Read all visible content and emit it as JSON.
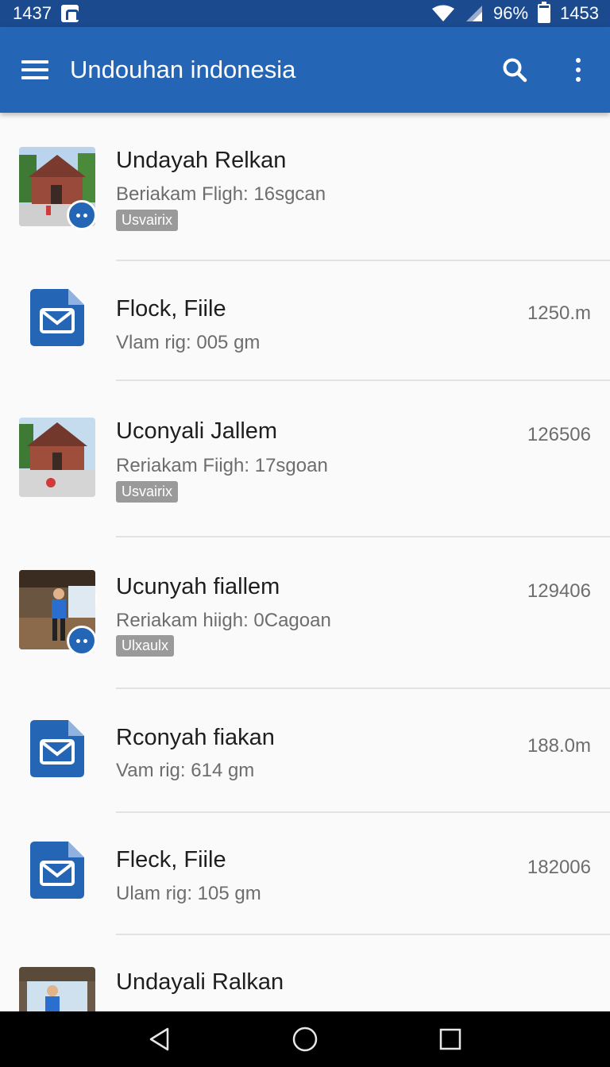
{
  "status_bar": {
    "time_left": "1437",
    "battery_percent": "96%",
    "time_right": "1453"
  },
  "app_bar": {
    "title": "Undouhan indonesia"
  },
  "items": [
    {
      "title": "Undayah Relkan",
      "subtitle": "Beriakam Fligh: 16sgcan",
      "tag": "Usvairix",
      "meta": "",
      "icon": "photo-thumbnail"
    },
    {
      "title": "Flock, Fiile",
      "subtitle": "Vlam rig: 005 gm",
      "tag": "",
      "meta": "1250.m",
      "icon": "mail-document-icon"
    },
    {
      "title": "Uconyali Jallem",
      "subtitle": "Reriakam Fiigh: 17sgoan",
      "tag": "Usvairix",
      "meta": "126506",
      "icon": "photo-thumbnail"
    },
    {
      "title": "Ucunyah fiallem",
      "subtitle": "Reriakam hiigh: 0Cagoan",
      "tag": "Ulxaulx",
      "meta": "129406",
      "icon": "photo-thumbnail"
    },
    {
      "title": "Rconyah fiakan",
      "subtitle": "Vam rig: 614 gm",
      "tag": "",
      "meta": "188.0m",
      "icon": "mail-document-icon"
    },
    {
      "title": "Fleck, Fiile",
      "subtitle": "Ulam rig: 105 gm",
      "tag": "",
      "meta": "182006",
      "icon": "mail-document-icon"
    },
    {
      "title": "Undayali Ralkan",
      "subtitle": "",
      "tag": "",
      "meta": "",
      "icon": "photo-thumbnail"
    }
  ],
  "colors": {
    "primary": "#2466b5",
    "status_bar": "#1b4a8f",
    "background": "#fafafa"
  }
}
